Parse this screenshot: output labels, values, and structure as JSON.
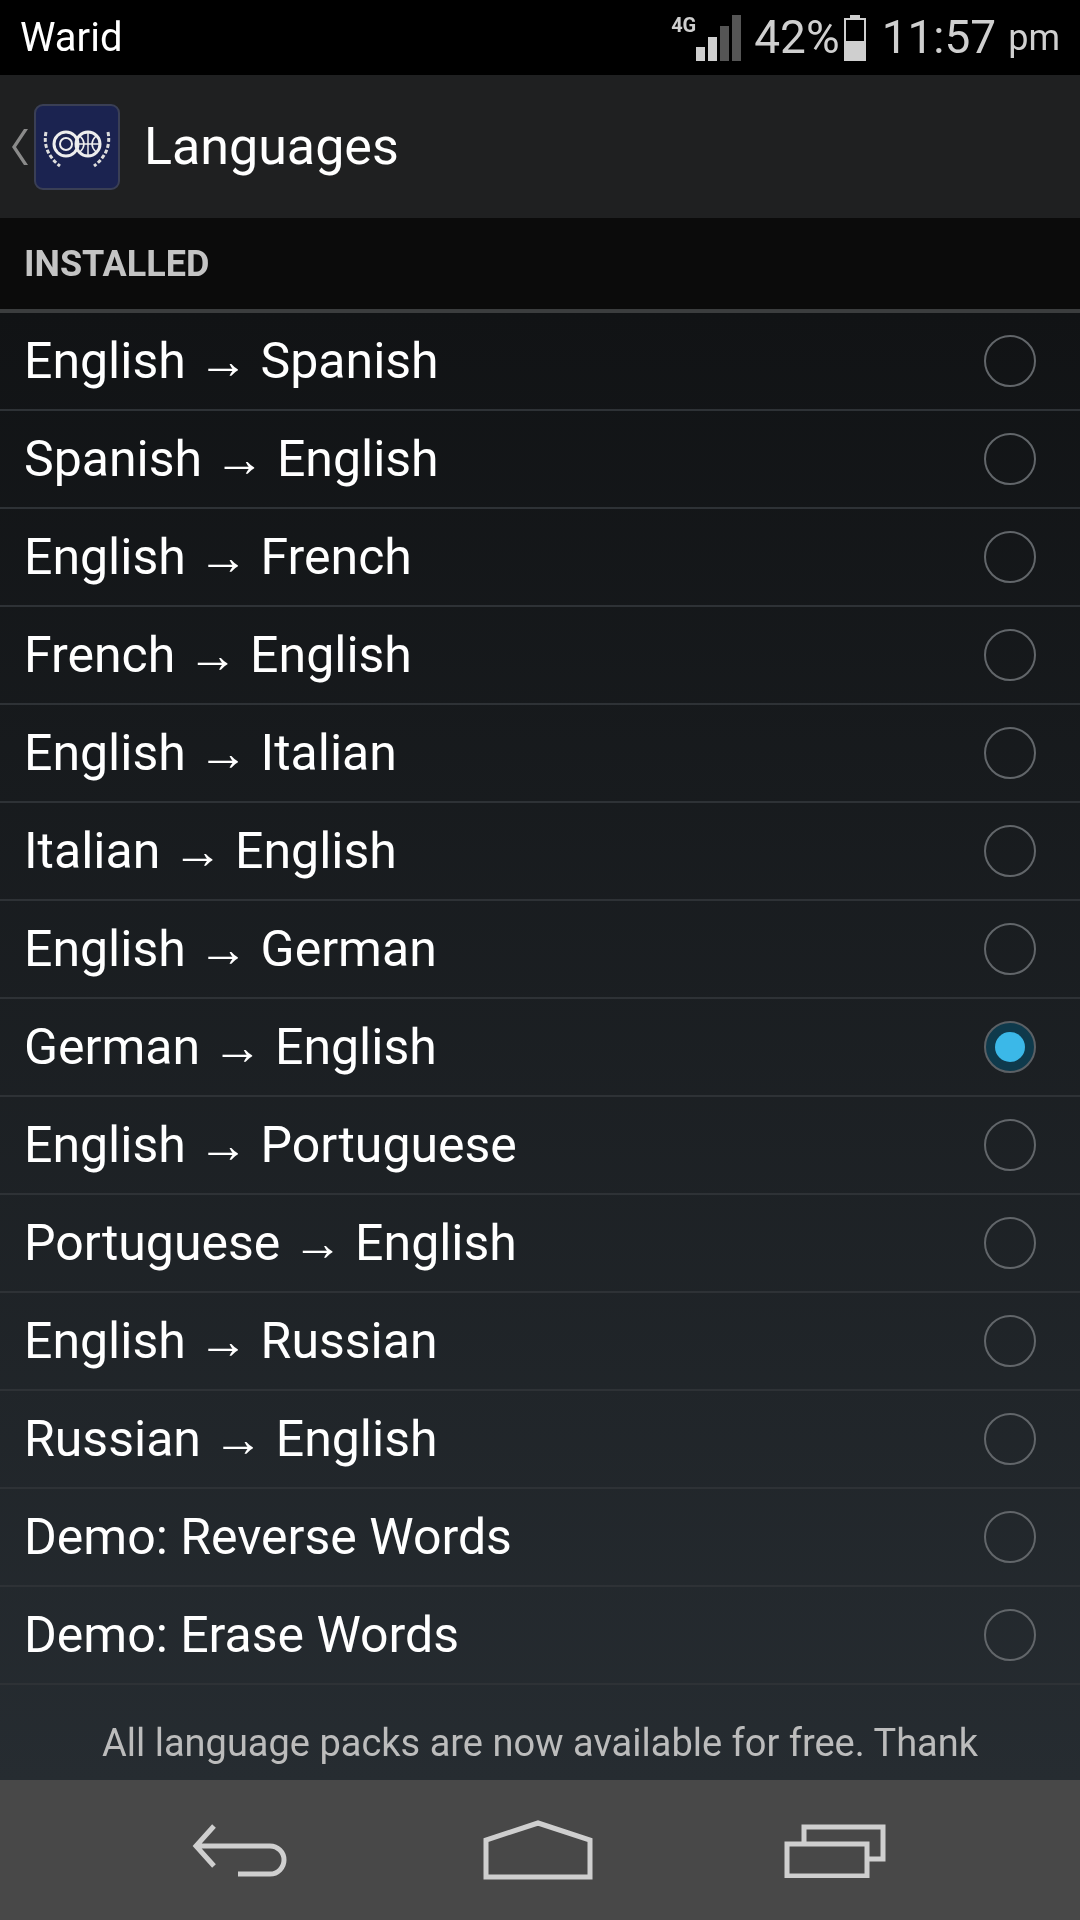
{
  "status_bar": {
    "carrier": "Warid",
    "network": "4G",
    "battery": "42%",
    "time": "11:57",
    "ampm": "pm"
  },
  "header": {
    "title": "Languages"
  },
  "section": {
    "title": "INSTALLED"
  },
  "items": [
    {
      "label": "English → Spanish",
      "selected": false
    },
    {
      "label": "Spanish → English",
      "selected": false
    },
    {
      "label": "English → French",
      "selected": false
    },
    {
      "label": "French → English",
      "selected": false
    },
    {
      "label": "English → Italian",
      "selected": false
    },
    {
      "label": "Italian → English",
      "selected": false
    },
    {
      "label": "English → German",
      "selected": false
    },
    {
      "label": "German → English",
      "selected": true
    },
    {
      "label": "English → Portuguese",
      "selected": false
    },
    {
      "label": "Portuguese → English",
      "selected": false
    },
    {
      "label": "English → Russian",
      "selected": false
    },
    {
      "label": "Russian → English",
      "selected": false
    },
    {
      "label": "Demo: Reverse Words",
      "selected": false
    },
    {
      "label": "Demo: Erase Words",
      "selected": false
    }
  ],
  "footer_text": "All language packs are now available for free. Thank"
}
